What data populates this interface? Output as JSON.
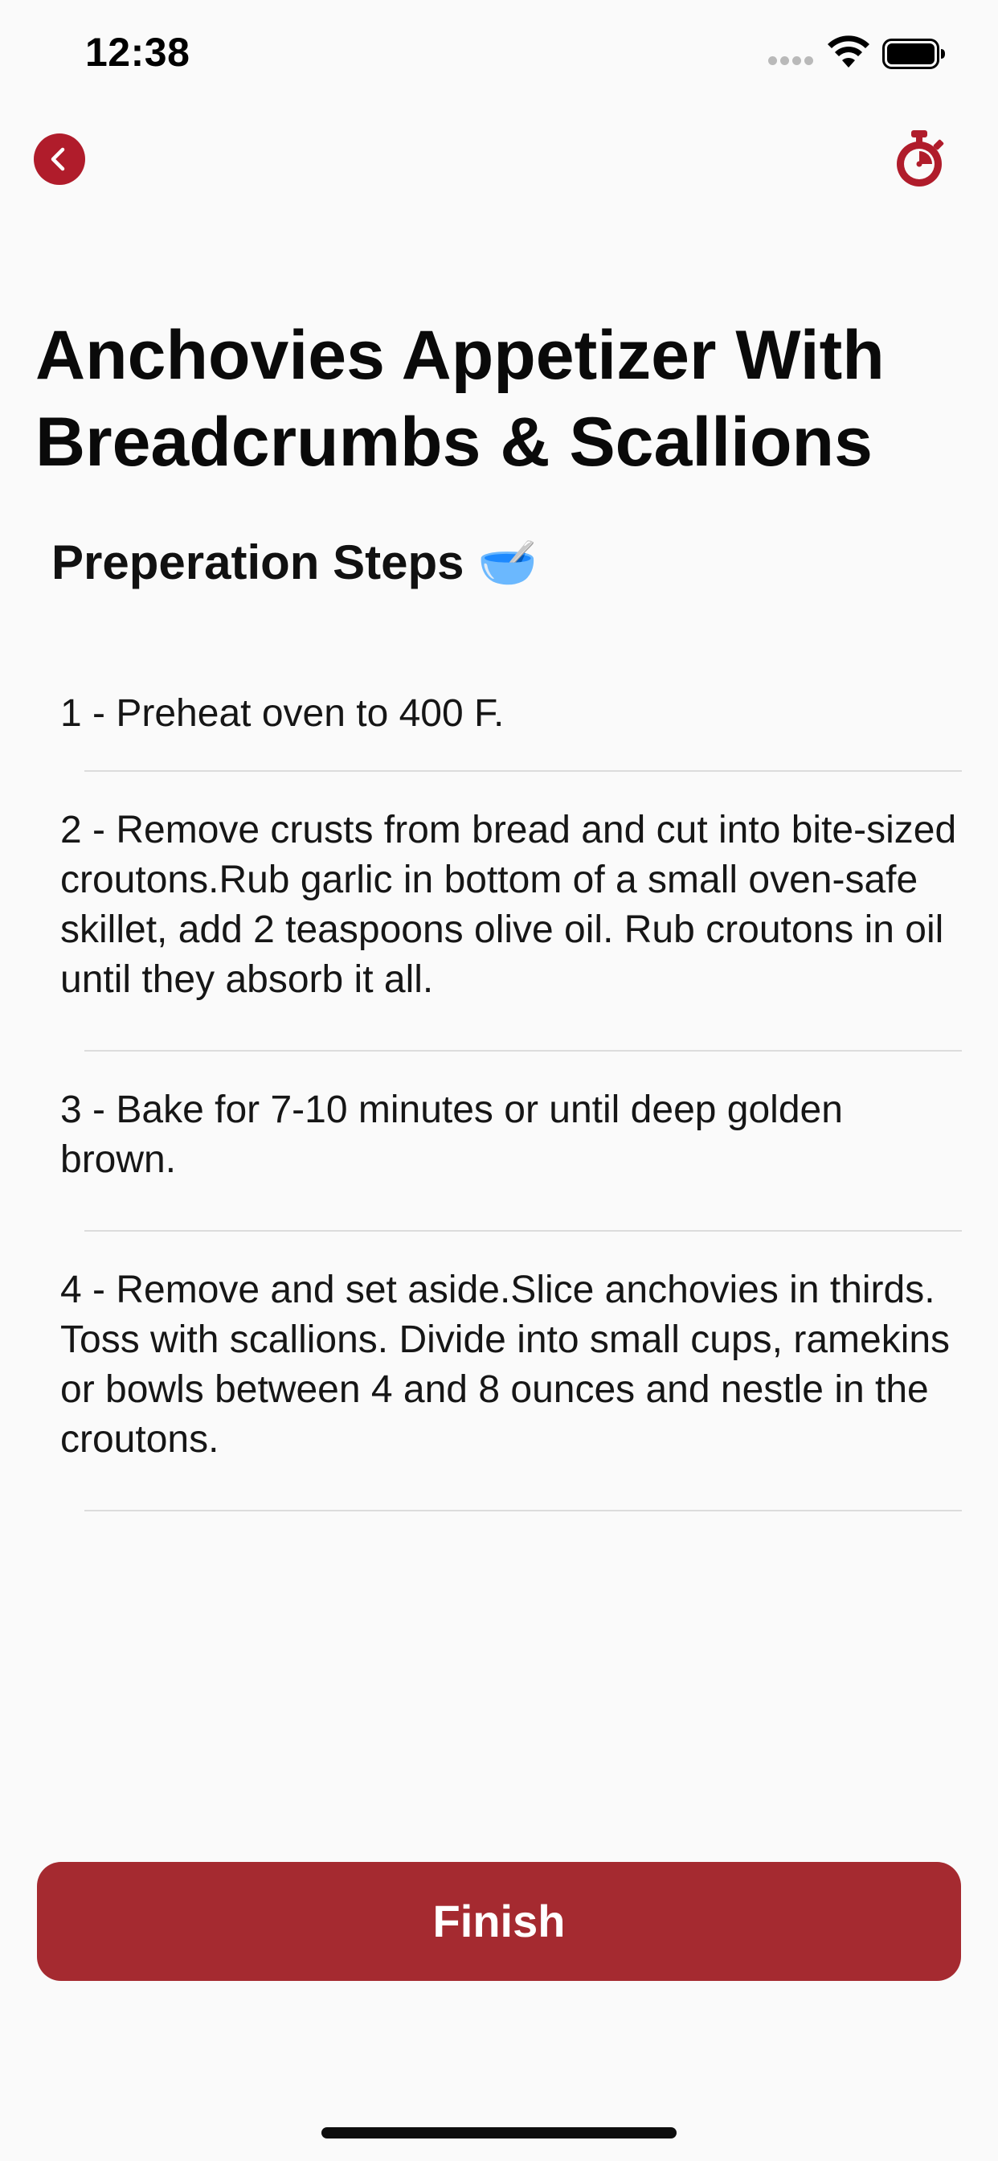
{
  "status_bar": {
    "time": "12:38"
  },
  "nav": {
    "back_icon": "chevron-left-icon",
    "timer_icon": "stopwatch-icon",
    "accent_color": "#b01c2b"
  },
  "recipe": {
    "title": "Anchovies Appetizer With Breadcrumbs & Scallions"
  },
  "section": {
    "heading": "Preperation Steps 🥣"
  },
  "steps": [
    {
      "number": "1",
      "text": "Preheat oven to 400 F."
    },
    {
      "number": "2",
      "text": "Remove crusts from bread and cut into bite-sized croutons.Rub garlic in bottom of a small oven-safe skillet, add 2 teaspoons olive oil. Rub croutons in oil until they absorb it all."
    },
    {
      "number": "3",
      "text": "Bake for 7-10 minutes or until deep golden brown."
    },
    {
      "number": "4",
      "text": "Remove and set aside.Slice anchovies in thirds. Toss with scallions. Divide into small cups, ramekins or bowls between 4 and 8 ounces and nestle in the croutons."
    }
  ],
  "step_separator": " - ",
  "finish_button": {
    "label": "Finish",
    "color": "#a52a30"
  }
}
